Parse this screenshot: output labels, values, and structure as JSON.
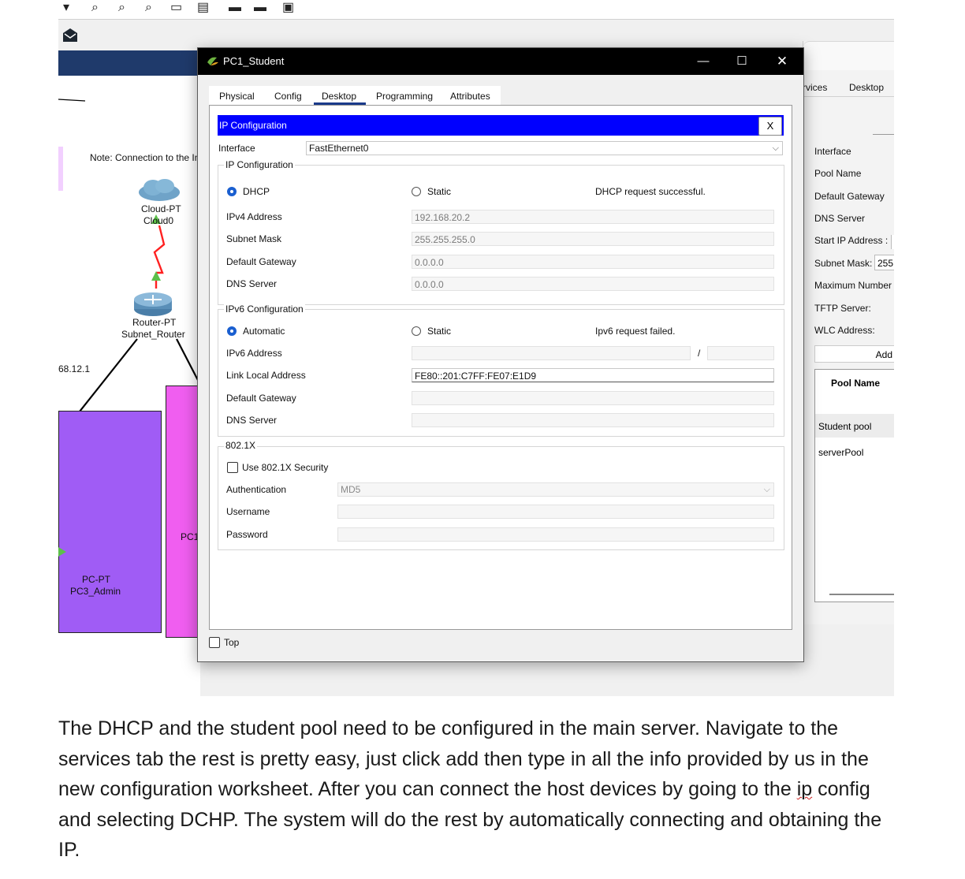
{
  "background_app": {
    "note_text": "Note: Connection to the In",
    "cloud_label_1": "Cloud-PT",
    "cloud_label_2": "Cloud0",
    "router_label_1": "Router-PT",
    "router_label_2": "Subnet_Router",
    "ip_fragment": "68.12.1",
    "pc3_label_1": "PC-PT",
    "pc3_label_2": "PC3_Admin",
    "pc1_fragment": "PC1"
  },
  "server_panel": {
    "tab_services": "rvices",
    "tab_desktop": "Desktop",
    "labels": [
      "Interface",
      "Pool Name",
      "Default Gateway",
      "DNS Server",
      "Start IP Address :",
      "Subnet Mask:",
      "Maximum Number o",
      "TFTP Server:",
      "WLC Address:"
    ],
    "subnet_value": "255",
    "add_button": "Add",
    "table_header": "Pool Name",
    "pools": [
      "Student pool",
      "serverPool"
    ]
  },
  "window": {
    "title": "PC1_Student",
    "tabs": [
      "Physical",
      "Config",
      "Desktop",
      "Programming",
      "Attributes"
    ],
    "active_tab": "Desktop",
    "top_checkbox_label": "Top"
  },
  "ip_config": {
    "header": "IP Configuration",
    "close_label": "X",
    "interface_label": "Interface",
    "interface_value": "FastEthernet0",
    "ipv4_group": "IP Configuration",
    "dhcp_label": "DHCP",
    "static_label": "Static",
    "dhcp_status": "DHCP request successful.",
    "ipv4_address_label": "IPv4 Address",
    "ipv4_address": "192.168.20.2",
    "subnet_mask_label": "Subnet Mask",
    "subnet_mask": "255.255.255.0",
    "gateway_label": "Default Gateway",
    "gateway": "0.0.0.0",
    "dns_label": "DNS Server",
    "dns": "0.0.0.0",
    "ipv6_group": "IPv6 Configuration",
    "auto_label": "Automatic",
    "static6_label": "Static",
    "ipv6_status": "Ipv6 request failed.",
    "ipv6_address_label": "IPv6 Address",
    "ipv6_slash": "/",
    "link_local_label": "Link Local Address",
    "link_local": "FE80::201:C7FF:FE07:E1D9",
    "gateway6_label": "Default Gateway",
    "dns6_label": "DNS Server",
    "dot1x_group": "802.1X",
    "use_dot1x_label": "Use 802.1X Security",
    "auth_label": "Authentication",
    "auth_value": "MD5",
    "username_label": "Username",
    "password_label": "Password"
  },
  "caption": {
    "text_before": "The DHCP and the student pool need to be configured in the main server. Navigate to the services tab the rest is pretty easy, just click add then type in all the info provided by us in the new configuration worksheet. After you can connect the host devices by going to the ",
    "underlined_word": "ip",
    "text_after": " config and selecting DCHP. The system will do the rest by automatically connecting and obtaining the IP."
  },
  "colors": {
    "ipc_header": "#0000ff",
    "lan_purple": "#a05cf5",
    "lan_pink": "#f05ef0",
    "title_bar": "#000000"
  }
}
